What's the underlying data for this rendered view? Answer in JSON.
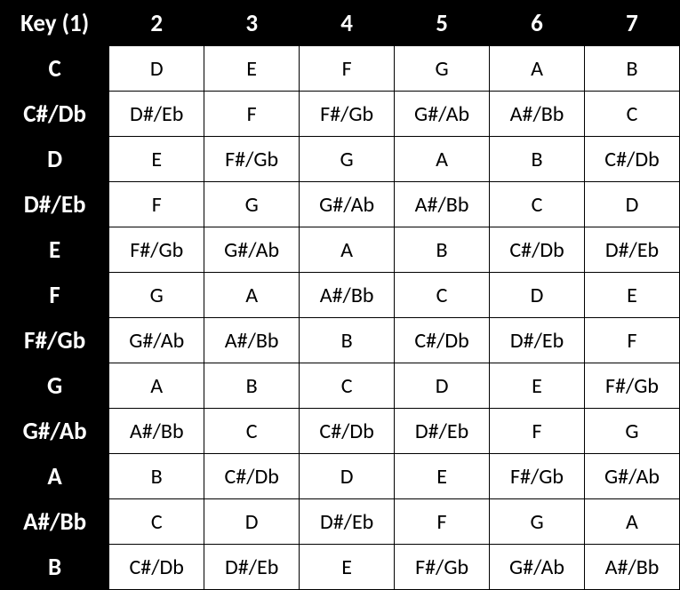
{
  "headers": [
    "Key (1)",
    "2",
    "3",
    "4",
    "5",
    "6",
    "7"
  ],
  "rows": [
    {
      "key": "C",
      "cells": [
        "D",
        "E",
        "F",
        "G",
        "A",
        "B"
      ]
    },
    {
      "key": "C#/Db",
      "cells": [
        "D#/Eb",
        "F",
        "F#/Gb",
        "G#/Ab",
        "A#/Bb",
        "C"
      ]
    },
    {
      "key": "D",
      "cells": [
        "E",
        "F#/Gb",
        "G",
        "A",
        "B",
        "C#/Db"
      ]
    },
    {
      "key": "D#/Eb",
      "cells": [
        "F",
        "G",
        "G#/Ab",
        "A#/Bb",
        "C",
        "D"
      ]
    },
    {
      "key": "E",
      "cells": [
        "F#/Gb",
        "G#/Ab",
        "A",
        "B",
        "C#/Db",
        "D#/Eb"
      ]
    },
    {
      "key": "F",
      "cells": [
        "G",
        "A",
        "A#/Bb",
        "C",
        "D",
        "E"
      ]
    },
    {
      "key": "F#/Gb",
      "cells": [
        "G#/Ab",
        "A#/Bb",
        "B",
        "C#/Db",
        "D#/Eb",
        "F"
      ]
    },
    {
      "key": "G",
      "cells": [
        "A",
        "B",
        "C",
        "D",
        "E",
        "F#/Gb"
      ]
    },
    {
      "key": "G#/Ab",
      "cells": [
        "A#/Bb",
        "C",
        "C#/Db",
        "D#/Eb",
        "F",
        "G"
      ]
    },
    {
      "key": "A",
      "cells": [
        "B",
        "C#/Db",
        "D",
        "E",
        "F#/Gb",
        "G#/Ab"
      ]
    },
    {
      "key": "A#/Bb",
      "cells": [
        "C",
        "D",
        "D#/Eb",
        "F",
        "G",
        "A"
      ]
    },
    {
      "key": "B",
      "cells": [
        "C#/Db",
        "D#/Eb",
        "E",
        "F#/Gb",
        "G#/Ab",
        "A#/Bb"
      ]
    }
  ]
}
